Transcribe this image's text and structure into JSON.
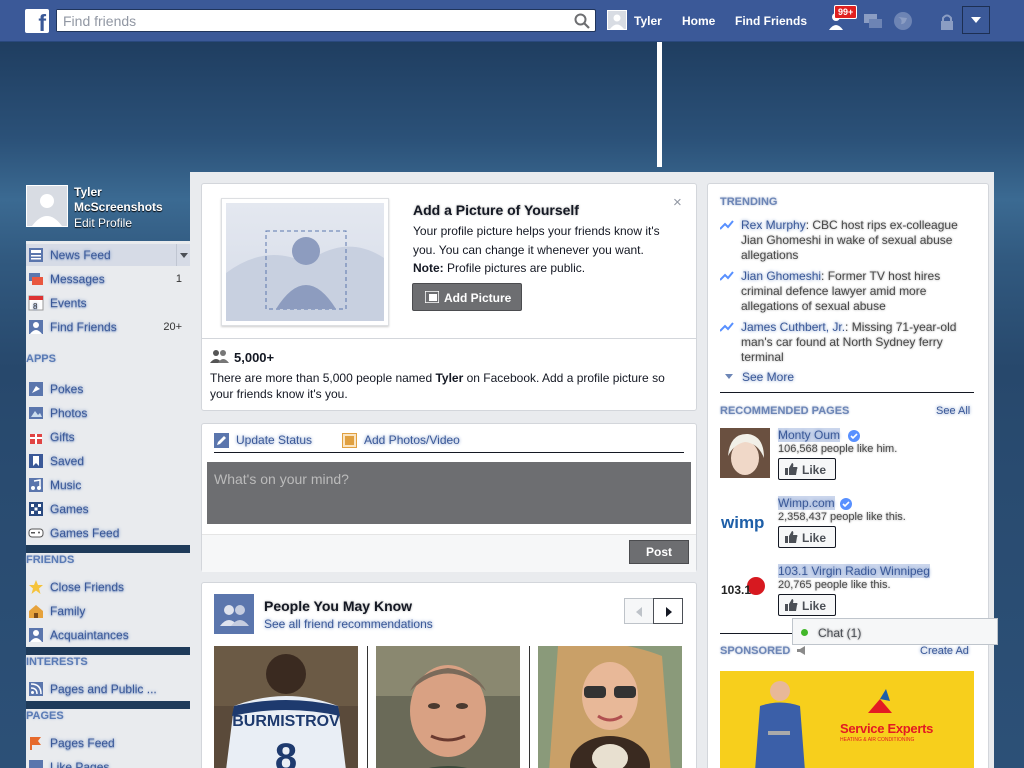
{
  "topbar": {
    "logo": "f",
    "search_placeholder": "Find friends",
    "user_name": "Tyler",
    "home": "Home",
    "find_friends": "Find Friends",
    "notif_count": "99+"
  },
  "profile": {
    "name": "Tyler McScreenshots",
    "edit": "Edit Profile"
  },
  "nav": {
    "news_feed": "News Feed",
    "messages": "Messages",
    "messages_count": "1",
    "events": "Events",
    "find_friends": "Find Friends",
    "find_friends_count": "20+",
    "apps_head": "APPS",
    "pokes": "Pokes",
    "photos": "Photos",
    "gifts": "Gifts",
    "saved": "Saved",
    "music": "Music",
    "games": "Games",
    "games_feed": "Games Feed",
    "friends_head": "FRIENDS",
    "close_friends": "Close Friends",
    "family": "Family",
    "acquaintances": "Acquaintances",
    "interests_head": "INTERESTS",
    "pages_public": "Pages and Public ...",
    "pages_head": "PAGES",
    "pages_feed": "Pages Feed",
    "like_pages": "Like Pages"
  },
  "add_picture": {
    "title": "Add a Picture of Yourself",
    "desc": "Your profile picture helps your friends know it's you. You can change it whenever you want.",
    "note_label": "Note:",
    "note_text": " Profile pictures are public.",
    "button": "Add Picture",
    "close": "×",
    "count": "5,000+",
    "people_desc_1": "There are more than 5,000 people named ",
    "people_name": "Tyler",
    "people_desc_2": " on Facebook. Add a profile picture so your friends know it's you."
  },
  "composer": {
    "update_status": "Update Status",
    "add_photos": "Add Photos/Video",
    "placeholder": "What's on your mind?",
    "post": "Post"
  },
  "pymk": {
    "title": "People You May Know",
    "sub": "See all friend recommendations",
    "jersey_text": "BURMISTROV",
    "jersey_number": "8"
  },
  "right": {
    "trending_head": "TRENDING",
    "trends": [
      {
        "name": "Rex Murphy",
        "text": ": CBC host rips ex-colleague Jian Ghomeshi in wake of sexual abuse allegations"
      },
      {
        "name": "Jian Ghomeshi",
        "text": ": Former TV host hires criminal defence lawyer amid more allegations of sexual abuse"
      },
      {
        "name": "James Cuthbert, Jr.",
        "text": ": Missing 71-year-old man's car found at North Sydney ferry terminal"
      }
    ],
    "see_more": "See More",
    "rec_head": "RECOMMENDED PAGES",
    "see_all": "See All",
    "recs": [
      {
        "name": "Monty Oum",
        "likes": "106,568 people like him.",
        "like": "Like"
      },
      {
        "name": "Wimp.com",
        "likes": "2,358,437 people like this.",
        "like": "Like",
        "logo": "wimp"
      },
      {
        "name": "103.1 Virgin Radio Winnipeg",
        "likes": "20,765 people like this.",
        "like": "Like",
        "logo": "103.1"
      }
    ],
    "sponsored": "SPONSORED",
    "create_ad": "Create Ad",
    "ad_brand": "Service Experts",
    "ad_sub": "HEATING & AIR CONDITIONING"
  },
  "chat": {
    "label": "Chat (1)"
  }
}
